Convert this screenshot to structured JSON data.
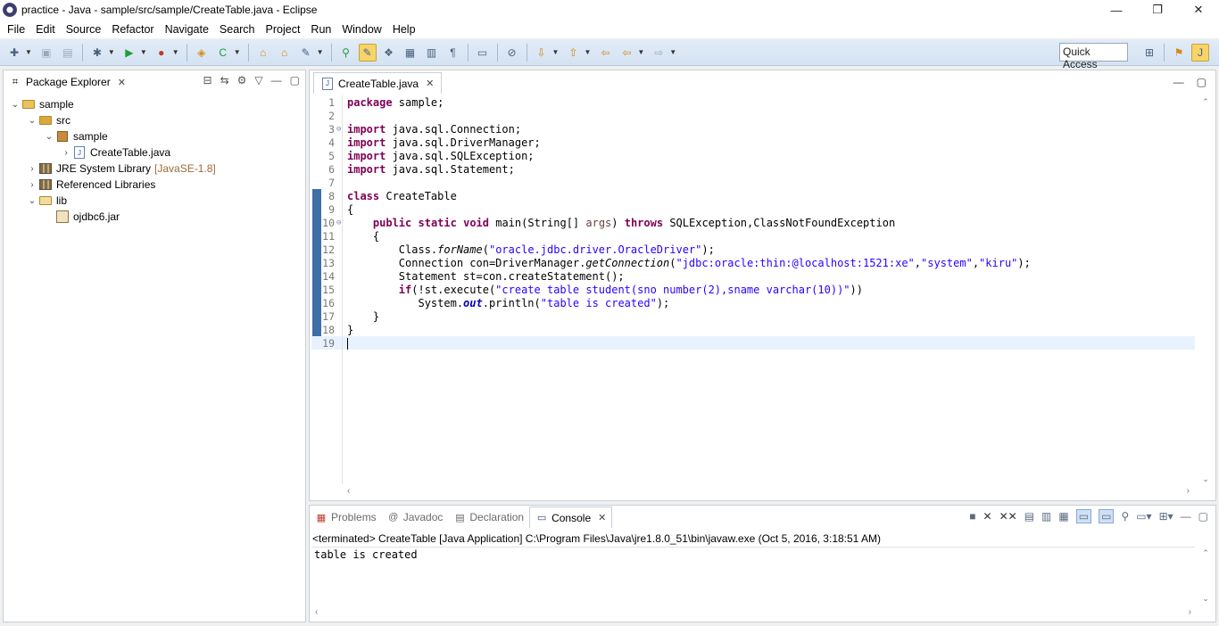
{
  "window": {
    "title": "practice - Java - sample/src/sample/CreateTable.java - Eclipse",
    "controls": {
      "minimize": "—",
      "maximize": "❐",
      "close": "✕"
    }
  },
  "menu": [
    "File",
    "Edit",
    "Source",
    "Refactor",
    "Navigate",
    "Search",
    "Project",
    "Run",
    "Window",
    "Help"
  ],
  "toolbar": {
    "quick_access": "Quick Access",
    "icons": [
      "new-icon",
      "save-icon",
      "save-all-icon",
      "debug-icon",
      "run-icon",
      "external-tools-icon",
      "new-java-project-icon",
      "new-class-icon",
      "open-type-icon",
      "search-icon",
      "toggle-mark-occurrences-icon",
      "next-annotation-icon",
      "prev-annotation-icon",
      "back-icon",
      "forward-icon"
    ]
  },
  "package_explorer": {
    "title": "Package Explorer",
    "tree": [
      {
        "label": "sample",
        "depth": 0,
        "twisty": "⌄",
        "icon": "project-icon"
      },
      {
        "label": "src",
        "depth": 1,
        "twisty": "⌄",
        "icon": "source-folder-icon"
      },
      {
        "label": "sample",
        "depth": 2,
        "twisty": "⌄",
        "icon": "package-icon"
      },
      {
        "label": "CreateTable.java",
        "depth": 3,
        "twisty": "›",
        "icon": "java-file-icon"
      },
      {
        "label": "JRE System Library",
        "secondary": "[JavaSE-1.8]",
        "depth": 1,
        "twisty": "›",
        "icon": "library-icon"
      },
      {
        "label": "Referenced Libraries",
        "depth": 1,
        "twisty": "›",
        "icon": "library-icon"
      },
      {
        "label": "lib",
        "depth": 1,
        "twisty": "⌄",
        "icon": "folder-icon"
      },
      {
        "label": "ojdbc6.jar",
        "depth": 2,
        "twisty": "",
        "icon": "jar-file-icon"
      }
    ]
  },
  "editor": {
    "tab_label": "CreateTable.java",
    "line_numbers": [
      "1",
      "2",
      "3",
      "4",
      "5",
      "6",
      "7",
      "8",
      "9",
      "10",
      "11",
      "12",
      "13",
      "14",
      "15",
      "16",
      "17",
      "18",
      "19"
    ],
    "lines": {
      "l1": [
        "package",
        " sample;"
      ],
      "l3": [
        "import",
        " java.sql.Connection;"
      ],
      "l4": [
        "import",
        " java.sql.DriverManager;"
      ],
      "l5": [
        "import",
        " java.sql.SQLException;"
      ],
      "l6": [
        "import",
        " java.sql.Statement;"
      ],
      "l8": [
        "class",
        " CreateTable"
      ],
      "l9": "{",
      "l10": [
        "    ",
        "public",
        " ",
        "static",
        " ",
        "void",
        " main(String[] ",
        "args",
        ") ",
        "throws",
        " SQLException,ClassNotFoundException"
      ],
      "l11": "    {",
      "l12": [
        "        Class.",
        "forName",
        "(",
        "\"oracle.jdbc.driver.OracleDriver\"",
        ");"
      ],
      "l13": [
        "        Connection con=DriverManager.",
        "getConnection",
        "(",
        "\"jdbc:oracle:thin:@localhost:1521:xe\"",
        ",",
        "\"system\"",
        ",",
        "\"kiru\"",
        ");"
      ],
      "l14": "        Statement st=con.createStatement();",
      "l15": [
        "        ",
        "if",
        "(!st.execute(",
        "\"create table student(sno number(2),sname varchar(10))\"",
        "))"
      ],
      "l16": [
        "           System.",
        "out",
        ".println(",
        "\"table is created\"",
        ");"
      ],
      "l17": "    }",
      "l18": "}"
    }
  },
  "console": {
    "tabs": [
      "Problems",
      "Javadoc",
      "Declaration",
      "Console"
    ],
    "terminated": "<terminated> CreateTable [Java Application] C:\\Program Files\\Java\\jre1.8.0_51\\bin\\javaw.exe (Oct 5, 2016, 3:18:51 AM)",
    "output": "table is created"
  }
}
